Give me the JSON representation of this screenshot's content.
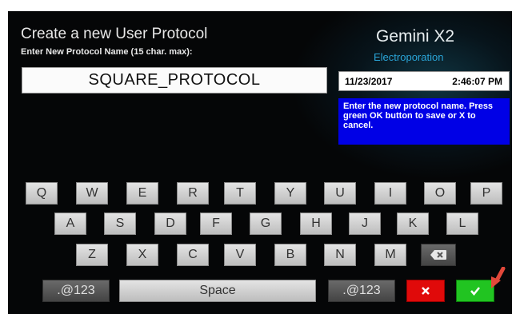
{
  "header": {
    "title": "Create a new User Protocol",
    "subtitle": "Enter New Protocol Name (15 char. max):",
    "brand": "Gemini X2",
    "brand_sub": "Electroporation"
  },
  "name_input": {
    "value": "SQUARE_PROTOCOL"
  },
  "status": {
    "date": "11/23/2017",
    "time": "2:46:07 PM"
  },
  "help_text": "Enter the new protocol name. Press green OK button to save or X to cancel.",
  "keyboard": {
    "row1": [
      "Q",
      "W",
      "E",
      "R",
      "T",
      "Y",
      "U",
      "I",
      "O",
      "P"
    ],
    "row2": [
      "A",
      "S",
      "D",
      "F",
      "G",
      "H",
      "J",
      "K",
      "L"
    ],
    "row3": [
      "Z",
      "X",
      "C",
      "V",
      "B",
      "N",
      "M"
    ],
    "symbols_label": ".@123",
    "space_label": "Space",
    "backspace_icon": "backspace-icon",
    "cancel_icon": "close-icon",
    "ok_icon": "checkmark-icon"
  },
  "colors": {
    "help_bg": "#0000e6",
    "cancel": "#e00a0a",
    "ok": "#21c421",
    "brand_sub": "#2aa5d8",
    "arrow": "#e2483a"
  }
}
